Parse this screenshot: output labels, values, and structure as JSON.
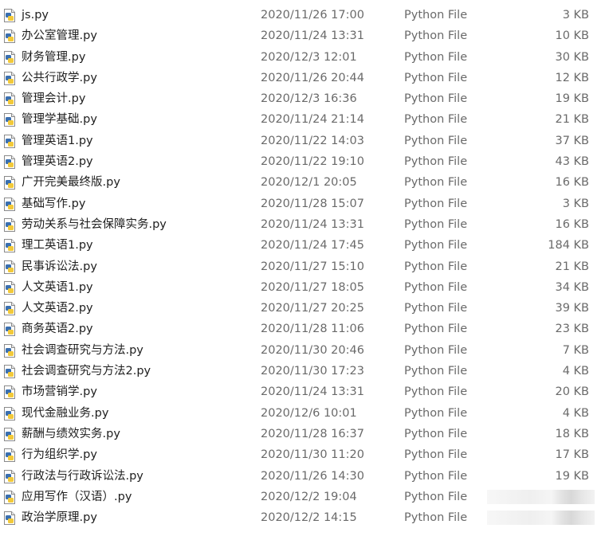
{
  "files": [
    {
      "name": "js.py",
      "date": "2020/11/26 17:00",
      "type": "Python File",
      "size": "3 KB"
    },
    {
      "name": "办公室管理.py",
      "date": "2020/11/24 13:31",
      "type": "Python File",
      "size": "10 KB"
    },
    {
      "name": "财务管理.py",
      "date": "2020/12/3 12:01",
      "type": "Python File",
      "size": "30 KB"
    },
    {
      "name": "公共行政学.py",
      "date": "2020/11/26 20:44",
      "type": "Python File",
      "size": "12 KB"
    },
    {
      "name": "管理会计.py",
      "date": "2020/12/3 16:36",
      "type": "Python File",
      "size": "19 KB"
    },
    {
      "name": "管理学基础.py",
      "date": "2020/11/24 21:14",
      "type": "Python File",
      "size": "21 KB"
    },
    {
      "name": "管理英语1.py",
      "date": "2020/11/22 14:03",
      "type": "Python File",
      "size": "37 KB"
    },
    {
      "name": "管理英语2.py",
      "date": "2020/11/22 19:10",
      "type": "Python File",
      "size": "43 KB"
    },
    {
      "name": "广开完美最终版.py",
      "date": "2020/12/1 20:05",
      "type": "Python File",
      "size": "16 KB"
    },
    {
      "name": "基础写作.py",
      "date": "2020/11/28 15:07",
      "type": "Python File",
      "size": "3 KB"
    },
    {
      "name": "劳动关系与社会保障实务.py",
      "date": "2020/11/24 13:31",
      "type": "Python File",
      "size": "16 KB"
    },
    {
      "name": "理工英语1.py",
      "date": "2020/11/24 17:45",
      "type": "Python File",
      "size": "184 KB"
    },
    {
      "name": "民事诉讼法.py",
      "date": "2020/11/27 15:10",
      "type": "Python File",
      "size": "21 KB"
    },
    {
      "name": "人文英语1.py",
      "date": "2020/11/27 18:05",
      "type": "Python File",
      "size": "34 KB"
    },
    {
      "name": "人文英语2.py",
      "date": "2020/11/27 20:25",
      "type": "Python File",
      "size": "39 KB"
    },
    {
      "name": "商务英语2.py",
      "date": "2020/11/28 11:06",
      "type": "Python File",
      "size": "23 KB"
    },
    {
      "name": "社会调查研究与方法.py",
      "date": "2020/11/30 20:46",
      "type": "Python File",
      "size": "7 KB"
    },
    {
      "name": "社会调查研究与方法2.py",
      "date": "2020/11/30 17:23",
      "type": "Python File",
      "size": "4 KB"
    },
    {
      "name": "市场营销学.py",
      "date": "2020/11/24 13:31",
      "type": "Python File",
      "size": "20 KB"
    },
    {
      "name": "现代金融业务.py",
      "date": "2020/12/6 10:01",
      "type": "Python File",
      "size": "4 KB"
    },
    {
      "name": "薪酬与绩效实务.py",
      "date": "2020/11/28 16:37",
      "type": "Python File",
      "size": "18 KB"
    },
    {
      "name": "行为组织学.py",
      "date": "2020/11/30 11:20",
      "type": "Python File",
      "size": "17 KB"
    },
    {
      "name": "行政法与行政诉讼法.py",
      "date": "2020/11/26 14:30",
      "type": "Python File",
      "size": "19 KB"
    },
    {
      "name": "应用写作（汉语）.py",
      "date": "2020/12/2 19:04",
      "type": "Python File",
      "size": null
    },
    {
      "name": "政治学原理.py",
      "date": "2020/12/2 14:15",
      "type": "Python File",
      "size": null
    }
  ],
  "icon": "python-file-icon",
  "colors": {
    "name": "#1e1e1e",
    "meta": "#6a6a6a",
    "python_blue": "#3a6fb0",
    "python_yellow": "#f2c93a"
  }
}
